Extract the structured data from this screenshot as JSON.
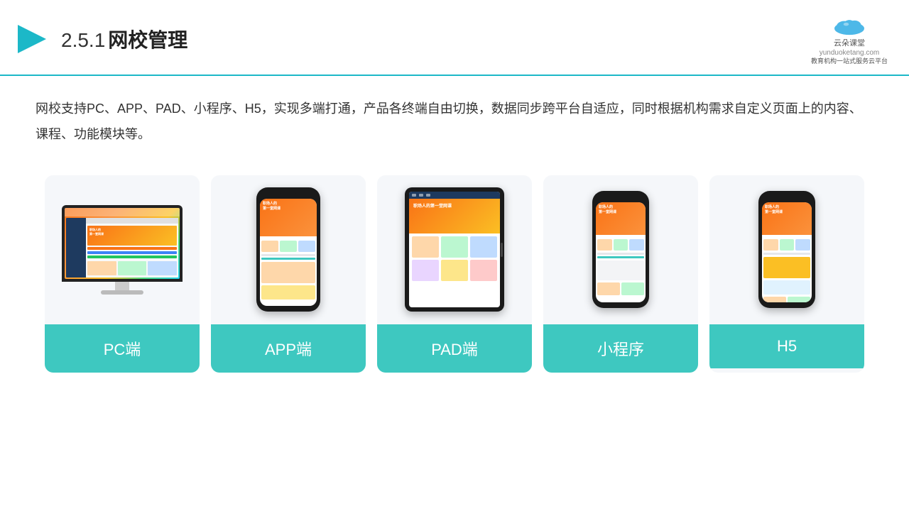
{
  "header": {
    "title": "2.5.1网校管理",
    "title_number": "2.5.1",
    "title_text": "网校管理"
  },
  "logo": {
    "name": "云朵课堂",
    "url": "yunduoketang.com",
    "slogan": "教育机构一站\n式服务云平台"
  },
  "description": "网校支持PC、APP、PAD、小程序、H5，实现多端打通，产品各终端自由切换，数据同步跨平台自适应，同时根据机构需求自定义页面上的内容、课程、功能模块等。",
  "cards": [
    {
      "id": "pc",
      "label": "PC端"
    },
    {
      "id": "app",
      "label": "APP端"
    },
    {
      "id": "pad",
      "label": "PAD端"
    },
    {
      "id": "miniprogram",
      "label": "小程序"
    },
    {
      "id": "h5",
      "label": "H5"
    }
  ],
  "accent_color": "#3ec8c0"
}
